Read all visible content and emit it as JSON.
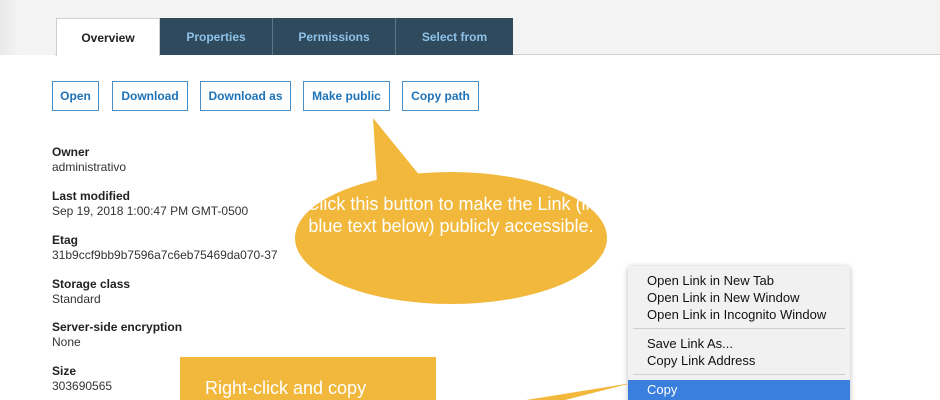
{
  "tabs": [
    {
      "label": "Overview",
      "active": true
    },
    {
      "label": "Properties",
      "active": false
    },
    {
      "label": "Permissions",
      "active": false
    },
    {
      "label": "Select from",
      "active": false
    }
  ],
  "actions": {
    "open": "Open",
    "download": "Download",
    "download_as": "Download as",
    "make_public": "Make public",
    "copy_path": "Copy path"
  },
  "properties": [
    {
      "label": "Owner",
      "value": "administrativo"
    },
    {
      "label": "Last modified",
      "value": "Sep 19, 2018 1:00:47 PM GMT-0500"
    },
    {
      "label": "Etag",
      "value": "31b9ccf9bb9b7596a7c6eb75469da070-37"
    },
    {
      "label": "Storage class",
      "value": "Standard"
    },
    {
      "label": "Server-side encryption",
      "value": "None"
    },
    {
      "label": "Size",
      "value": "303690565"
    }
  ],
  "callouts": {
    "bubble_text": "Click this button to make the Link (in blue text below) publicly accessible.",
    "box_text": "Right-click and copy"
  },
  "context_menu": {
    "items": [
      "Open Link in New Tab",
      "Open Link in New Window",
      "Open Link in Incognito Window",
      "Save Link As...",
      "Copy Link Address",
      "Copy"
    ],
    "highlighted": "Copy"
  },
  "colors": {
    "tab_inactive_bg": "#2f4a5c",
    "tab_inactive_text": "#8ec1e8",
    "button_border": "#4a90c8",
    "callout": "#f1b83c",
    "menu_highlight": "#3a7fde"
  }
}
